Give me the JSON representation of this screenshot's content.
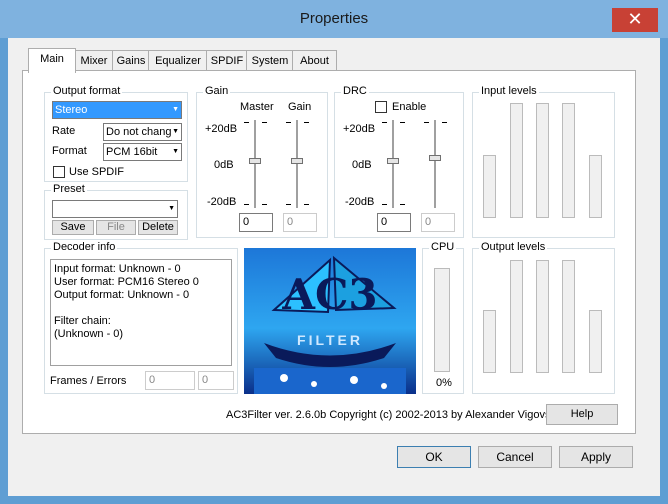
{
  "window": {
    "title": "Properties",
    "close_symbol": "✕"
  },
  "tabs": [
    "Main",
    "Mixer",
    "Gains",
    "Equalizer",
    "SPDIF",
    "System",
    "About"
  ],
  "output_format": {
    "caption": "Output format",
    "format_value": "Stereo",
    "rate_label": "Rate",
    "rate_value": "Do not chang",
    "format_label": "Format",
    "format_sel": "PCM 16bit",
    "use_spdif_label": "Use SPDIF"
  },
  "preset": {
    "caption": "Preset",
    "value": "",
    "save": "Save",
    "file": "File",
    "delete": "Delete"
  },
  "gain": {
    "caption": "Gain",
    "master_label": "Master",
    "gain_label": "Gain",
    "plus20": "+20dB",
    "zero": "0dB",
    "minus20": "-20dB",
    "master_value": "0",
    "gain_value": "0"
  },
  "drc": {
    "caption": "DRC",
    "enable_label": "Enable",
    "plus20": "+20dB",
    "zero": "0dB",
    "minus20": "-20dB",
    "value1": "0",
    "value2": "0"
  },
  "input_levels": {
    "caption": "Input levels"
  },
  "output_levels": {
    "caption": "Output levels"
  },
  "decoder": {
    "caption": "Decoder info",
    "lines": [
      "Input format: Unknown - 0",
      "User format: PCM16 Stereo 0",
      "Output format: Unknown - 0",
      "",
      "Filter chain:",
      "(Unknown - 0)"
    ],
    "frames_label": "Frames / Errors",
    "frames": "0",
    "errors": "0"
  },
  "cpu": {
    "caption": "CPU",
    "value": "0%"
  },
  "logo": {
    "text": "AC3",
    "subtext": "FILTER"
  },
  "footer": {
    "copyright": "AC3Filter ver. 2.6.0b Copyright (c) 2002-2013 by Alexander Vigovsky",
    "help": "Help"
  },
  "dialog_buttons": {
    "ok": "OK",
    "cancel": "Cancel",
    "apply": "Apply"
  }
}
